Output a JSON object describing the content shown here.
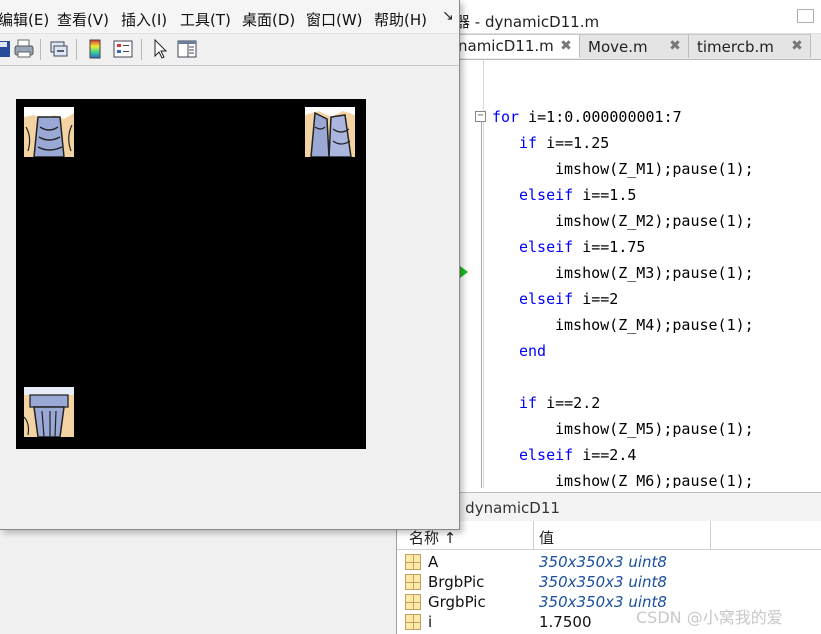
{
  "editor": {
    "title": "器 - dynamicD11.m",
    "tabs": [
      {
        "label": "namicD11.m",
        "active": true
      },
      {
        "label": "Move.m",
        "active": false
      },
      {
        "label": "timercb.m",
        "active": false
      }
    ],
    "tab_close_glyph": "✖",
    "fold_glyph": "−",
    "code": [
      {
        "kw": "for",
        "rest": " i=1:0.000000001:7"
      },
      {
        "kw": "if",
        "rest": " i==1.25"
      },
      {
        "kw": "",
        "rest": "imshow(Z_M1);pause(1);"
      },
      {
        "kw": "elseif",
        "rest": " i==1.5"
      },
      {
        "kw": "",
        "rest": "imshow(Z_M2);pause(1);"
      },
      {
        "kw": "elseif",
        "rest": " i==1.75"
      },
      {
        "kw": "",
        "rest": "imshow(Z_M3);pause(1);"
      },
      {
        "kw": "elseif",
        "rest": " i==2"
      },
      {
        "kw": "",
        "rest": "imshow(Z_M4);pause(1);"
      },
      {
        "kw": "end",
        "rest": ""
      },
      {
        "kw": "",
        "rest": ""
      },
      {
        "kw": "if",
        "rest": " i==2.2"
      },
      {
        "kw": "",
        "rest": "imshow(Z_M5);pause(1);"
      },
      {
        "kw": "elseif",
        "rest": " i==2.4"
      },
      {
        "kw": "",
        "rest": "imshow(Z_M6);pause(1);"
      }
    ]
  },
  "workspace": {
    "title": "- dynamicD11",
    "col_name": "名称 ↑",
    "col_value": "值",
    "rows": [
      {
        "name": "A",
        "value": "350x350x3 uint8"
      },
      {
        "name": "BrgbPic",
        "value": "350x350x3 uint8"
      },
      {
        "name": "GrgbPic",
        "value": "350x350x3 uint8"
      },
      {
        "name": "i",
        "value": "1.7500"
      }
    ]
  },
  "figure": {
    "menus": [
      "编辑(E)",
      "查看(V)",
      "插入(I)",
      "工具(T)",
      "桌面(D)",
      "窗口(W)",
      "帮助(H)"
    ],
    "menu_overflow": "↘",
    "toolbar_icons": [
      "save-icon",
      "print-icon",
      "link-icon",
      "colorbar-icon",
      "legend-icon",
      "pointer-icon",
      "property-editor-icon"
    ]
  },
  "watermark": "CSDN @小窝我的爱",
  "colors": {
    "keyword": "#0000ff",
    "variable_value": "#1a4fa0",
    "canvas_bg": "#000000",
    "exec_arrow": "#22bb22"
  }
}
